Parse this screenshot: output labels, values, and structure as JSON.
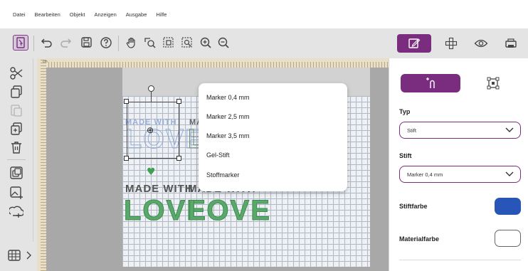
{
  "menu": [
    "Datei",
    "Bearbeiten",
    "Objekt",
    "Anzeigen",
    "Ausgabe",
    "Hilfe"
  ],
  "toolbar": {
    "buttons": [
      "select-icon",
      "undo-icon",
      "redo-icon",
      "save-icon",
      "help-icon",
      "pan-hand-icon",
      "zoom-box-icon",
      "zoom-fit-icon",
      "zoom-selection-icon",
      "zoom-in-icon",
      "zoom-out-icon"
    ]
  },
  "mode_tabs": [
    "edit-icon",
    "arrange-icon",
    "preview-icon",
    "output-icon"
  ],
  "left_tools": [
    "cut-icon",
    "copy-icon",
    "paste-icon",
    "duplicate-icon",
    "delete-icon",
    "group-icon",
    "image-edit-icon",
    "shape-library-icon"
  ],
  "ruler": {
    "unit": "cm"
  },
  "design": {
    "made_with": "MADE WITH",
    "love": "LOVE"
  },
  "dropdown": {
    "items": [
      "Marker 0,4 mm",
      "Marker 2,5 mm",
      "Marker 3,5 mm",
      "Gel-Stift",
      "Stoffmarker"
    ]
  },
  "panel": {
    "typ_label": "Typ",
    "typ_value": "Stift",
    "stift_label": "Stift",
    "stift_value": "Marker 0,4 mm",
    "stiftfarbe_label": "Stiftfarbe",
    "stiftfarbe_color": "#2856b8",
    "materialfarbe_label": "Materialfarbe",
    "materialfarbe_color": "#ffffff"
  },
  "colors": {
    "accent": "#7a2c7f"
  }
}
